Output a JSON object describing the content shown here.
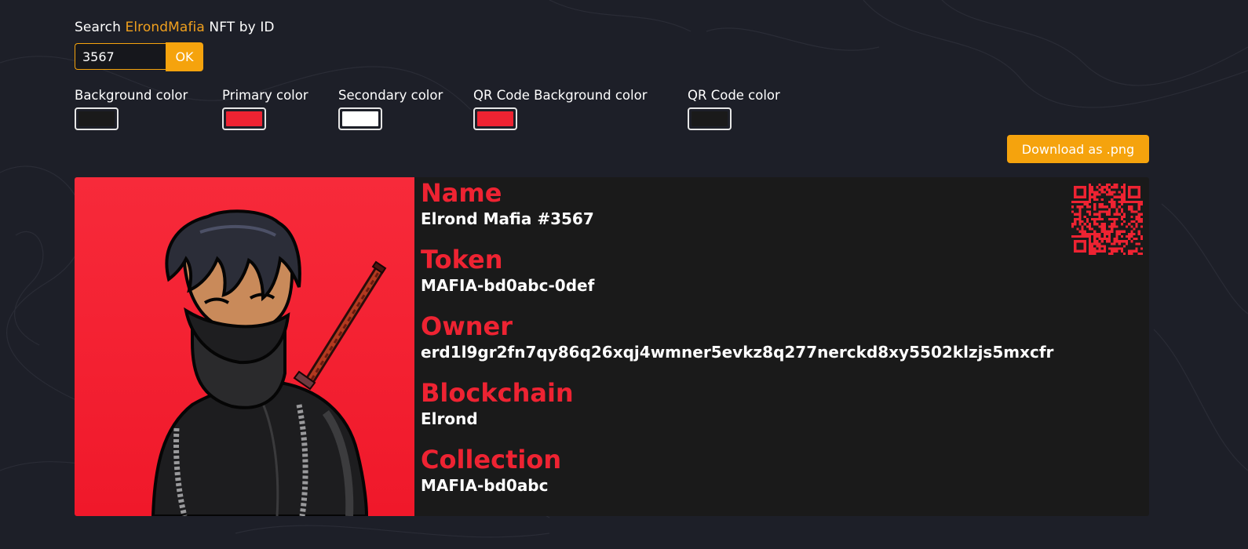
{
  "search": {
    "label_prefix": "Search ",
    "label_brand": "ElrondMafia",
    "label_suffix": " NFT by ID",
    "value": "3567",
    "ok_label": "OK"
  },
  "colors": [
    {
      "label": "Background color",
      "value": "#1a1a1a"
    },
    {
      "label": "Primary color",
      "value": "#ee2332"
    },
    {
      "label": "Secondary color",
      "value": "#ffffff"
    },
    {
      "label": "QR Code Background color",
      "value": "#ee2332"
    },
    {
      "label": "QR Code color",
      "value": "#1a1a1a"
    }
  ],
  "download_label": "Download as .png",
  "nft": {
    "fields": [
      {
        "label": "Name",
        "value": "Elrond Mafia #3567"
      },
      {
        "label": "Token",
        "value": "MAFIA-bd0abc-0def"
      },
      {
        "label": "Owner",
        "value": "erd1l9gr2fn7qy86q26xqj4wmner5evkz8q277nerckd8xy5502klzjs5mxcfr"
      },
      {
        "label": "Blockchain",
        "value": "Elrond"
      },
      {
        "label": "Collection",
        "value": "MAFIA-bd0abc"
      }
    ],
    "image_icon": "ninja-avatar",
    "qr_icon": "qr-code"
  },
  "theme": {
    "accent": "#f5a30d",
    "brand": "#f0a01e",
    "primary": "#ee2332",
    "page_background": "#1d1f28",
    "card_background": "#1a1a1a"
  }
}
